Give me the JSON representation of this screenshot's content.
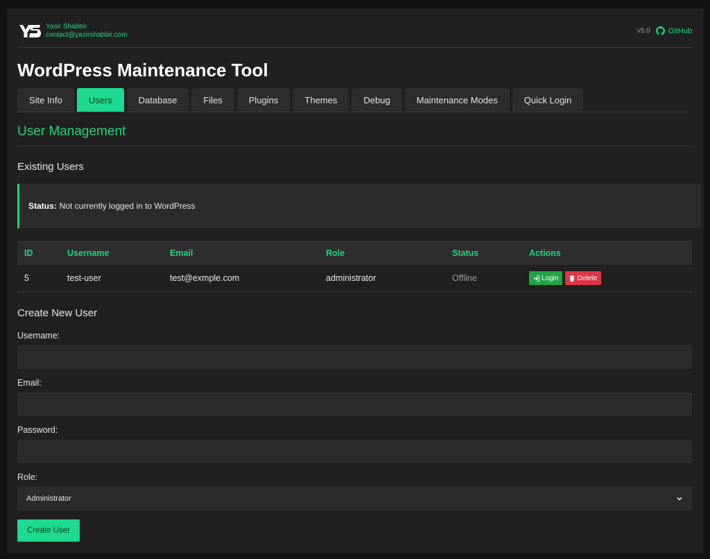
{
  "header": {
    "author_name": "Yasir Shabbir",
    "author_email": "contact@yasirshabbir.com",
    "version": "v5.0",
    "github_label": "GitHub"
  },
  "page_title": "WordPress Maintenance Tool",
  "tabs": [
    {
      "label": "Site Info",
      "active": false
    },
    {
      "label": "Users",
      "active": true
    },
    {
      "label": "Database",
      "active": false
    },
    {
      "label": "Files",
      "active": false
    },
    {
      "label": "Plugins",
      "active": false
    },
    {
      "label": "Themes",
      "active": false
    },
    {
      "label": "Debug",
      "active": false
    },
    {
      "label": "Maintenance Modes",
      "active": false
    },
    {
      "label": "Quick Login",
      "active": false
    }
  ],
  "section_title": "User Management",
  "existing_users": {
    "heading": "Existing Users",
    "status_label": "Status:",
    "status_text": "Not currently logged in to WordPress",
    "columns": [
      "ID",
      "Username",
      "Email",
      "Role",
      "Status",
      "Actions"
    ],
    "rows": [
      {
        "id": "5",
        "username": "test-user",
        "email": "test@exmple.com",
        "role": "administrator",
        "status": "Offline",
        "login_label": "Login",
        "delete_label": "Delete"
      }
    ]
  },
  "create_user": {
    "heading": "Create New User",
    "username_label": "Username:",
    "username_value": "",
    "email_label": "Email:",
    "email_value": "",
    "password_label": "Password:",
    "password_value": "",
    "role_label": "Role:",
    "role_selected": "Administrator",
    "submit_label": "Create User"
  },
  "colors": {
    "accent": "#1ed990",
    "background": "#202020",
    "danger": "#dc3545",
    "success": "#21a344"
  },
  "icons": [
    "ys-logo",
    "github-icon",
    "sign-in-icon",
    "trash-icon",
    "chevron-down-icon"
  ]
}
